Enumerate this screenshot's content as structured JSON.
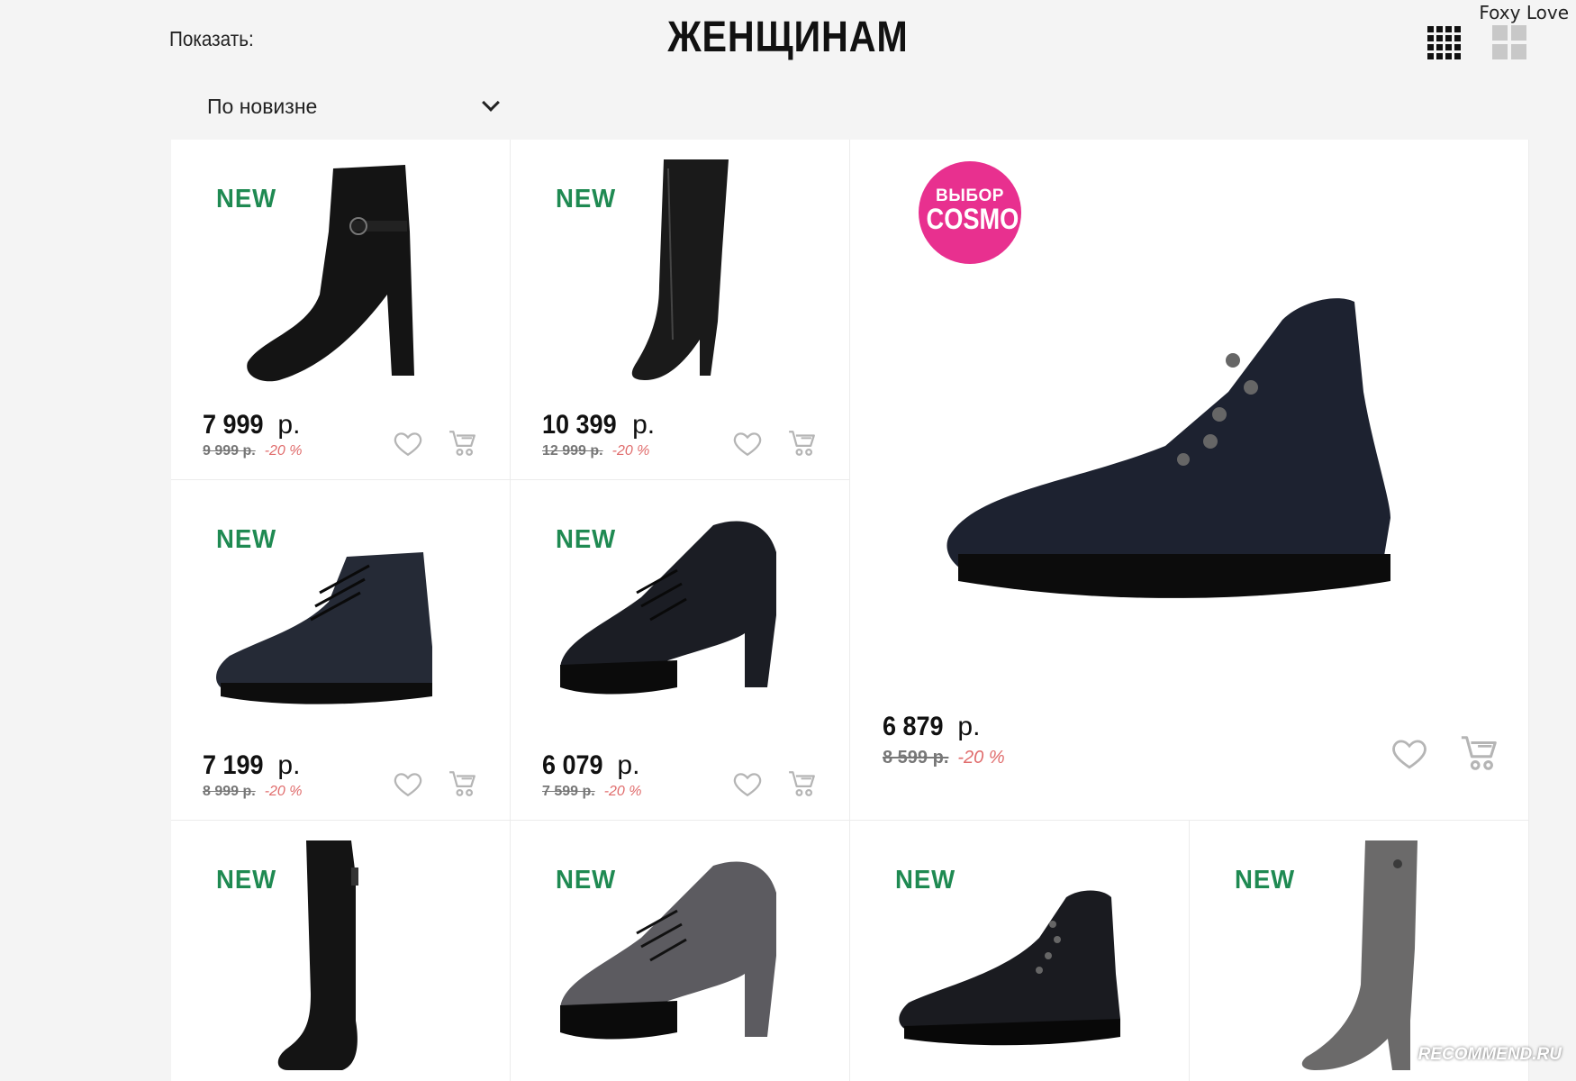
{
  "header": {
    "show_label": "Показать:",
    "title": "ЖЕНЩИНАМ",
    "sort_value": "По новизне",
    "view_small_icon": "grid-small-icon",
    "view_large_icon": "grid-large-icon"
  },
  "watermarks": {
    "top": "Foxy Love",
    "bottom": "RECOMMEND.RU"
  },
  "colors": {
    "new_badge": "#1f8a52",
    "discount": "#e06c6c",
    "cosmo_badge": "#e8308f"
  },
  "products": [
    {
      "badge": "NEW",
      "price": "7 999",
      "currency": "р.",
      "old_price": "9 999 р.",
      "discount": "-20 %",
      "item": "black-suede-ankle-boot"
    },
    {
      "badge": "NEW",
      "price": "10 399",
      "currency": "р.",
      "old_price": "12 999 р.",
      "discount": "-20 %",
      "item": "black-over-knee-boot"
    },
    {
      "badge": "ВЫБОР COSMO",
      "badge_line1": "ВЫБОР",
      "badge_line2": "COSMO",
      "price": "6 879",
      "currency": "р.",
      "old_price": "8 599 р.",
      "discount": "-20 %",
      "item": "black-lace-up-ankle-boot"
    },
    {
      "badge": "NEW",
      "price": "7 199",
      "currency": "р.",
      "old_price": "8 999 р.",
      "discount": "-20 %",
      "item": "black-lace-up-low-boot"
    },
    {
      "badge": "NEW",
      "price": "6 079",
      "currency": "р.",
      "old_price": "7 599 р.",
      "discount": "-20 %",
      "item": "black-heeled-oxford"
    },
    {
      "badge": "NEW",
      "item": "black-tall-flat-boot"
    },
    {
      "badge": "NEW",
      "item": "grey-heeled-oxford"
    },
    {
      "badge": "NEW",
      "item": "black-lace-up-ankle-boot"
    },
    {
      "badge": "NEW",
      "item": "grey-tall-boot"
    }
  ]
}
